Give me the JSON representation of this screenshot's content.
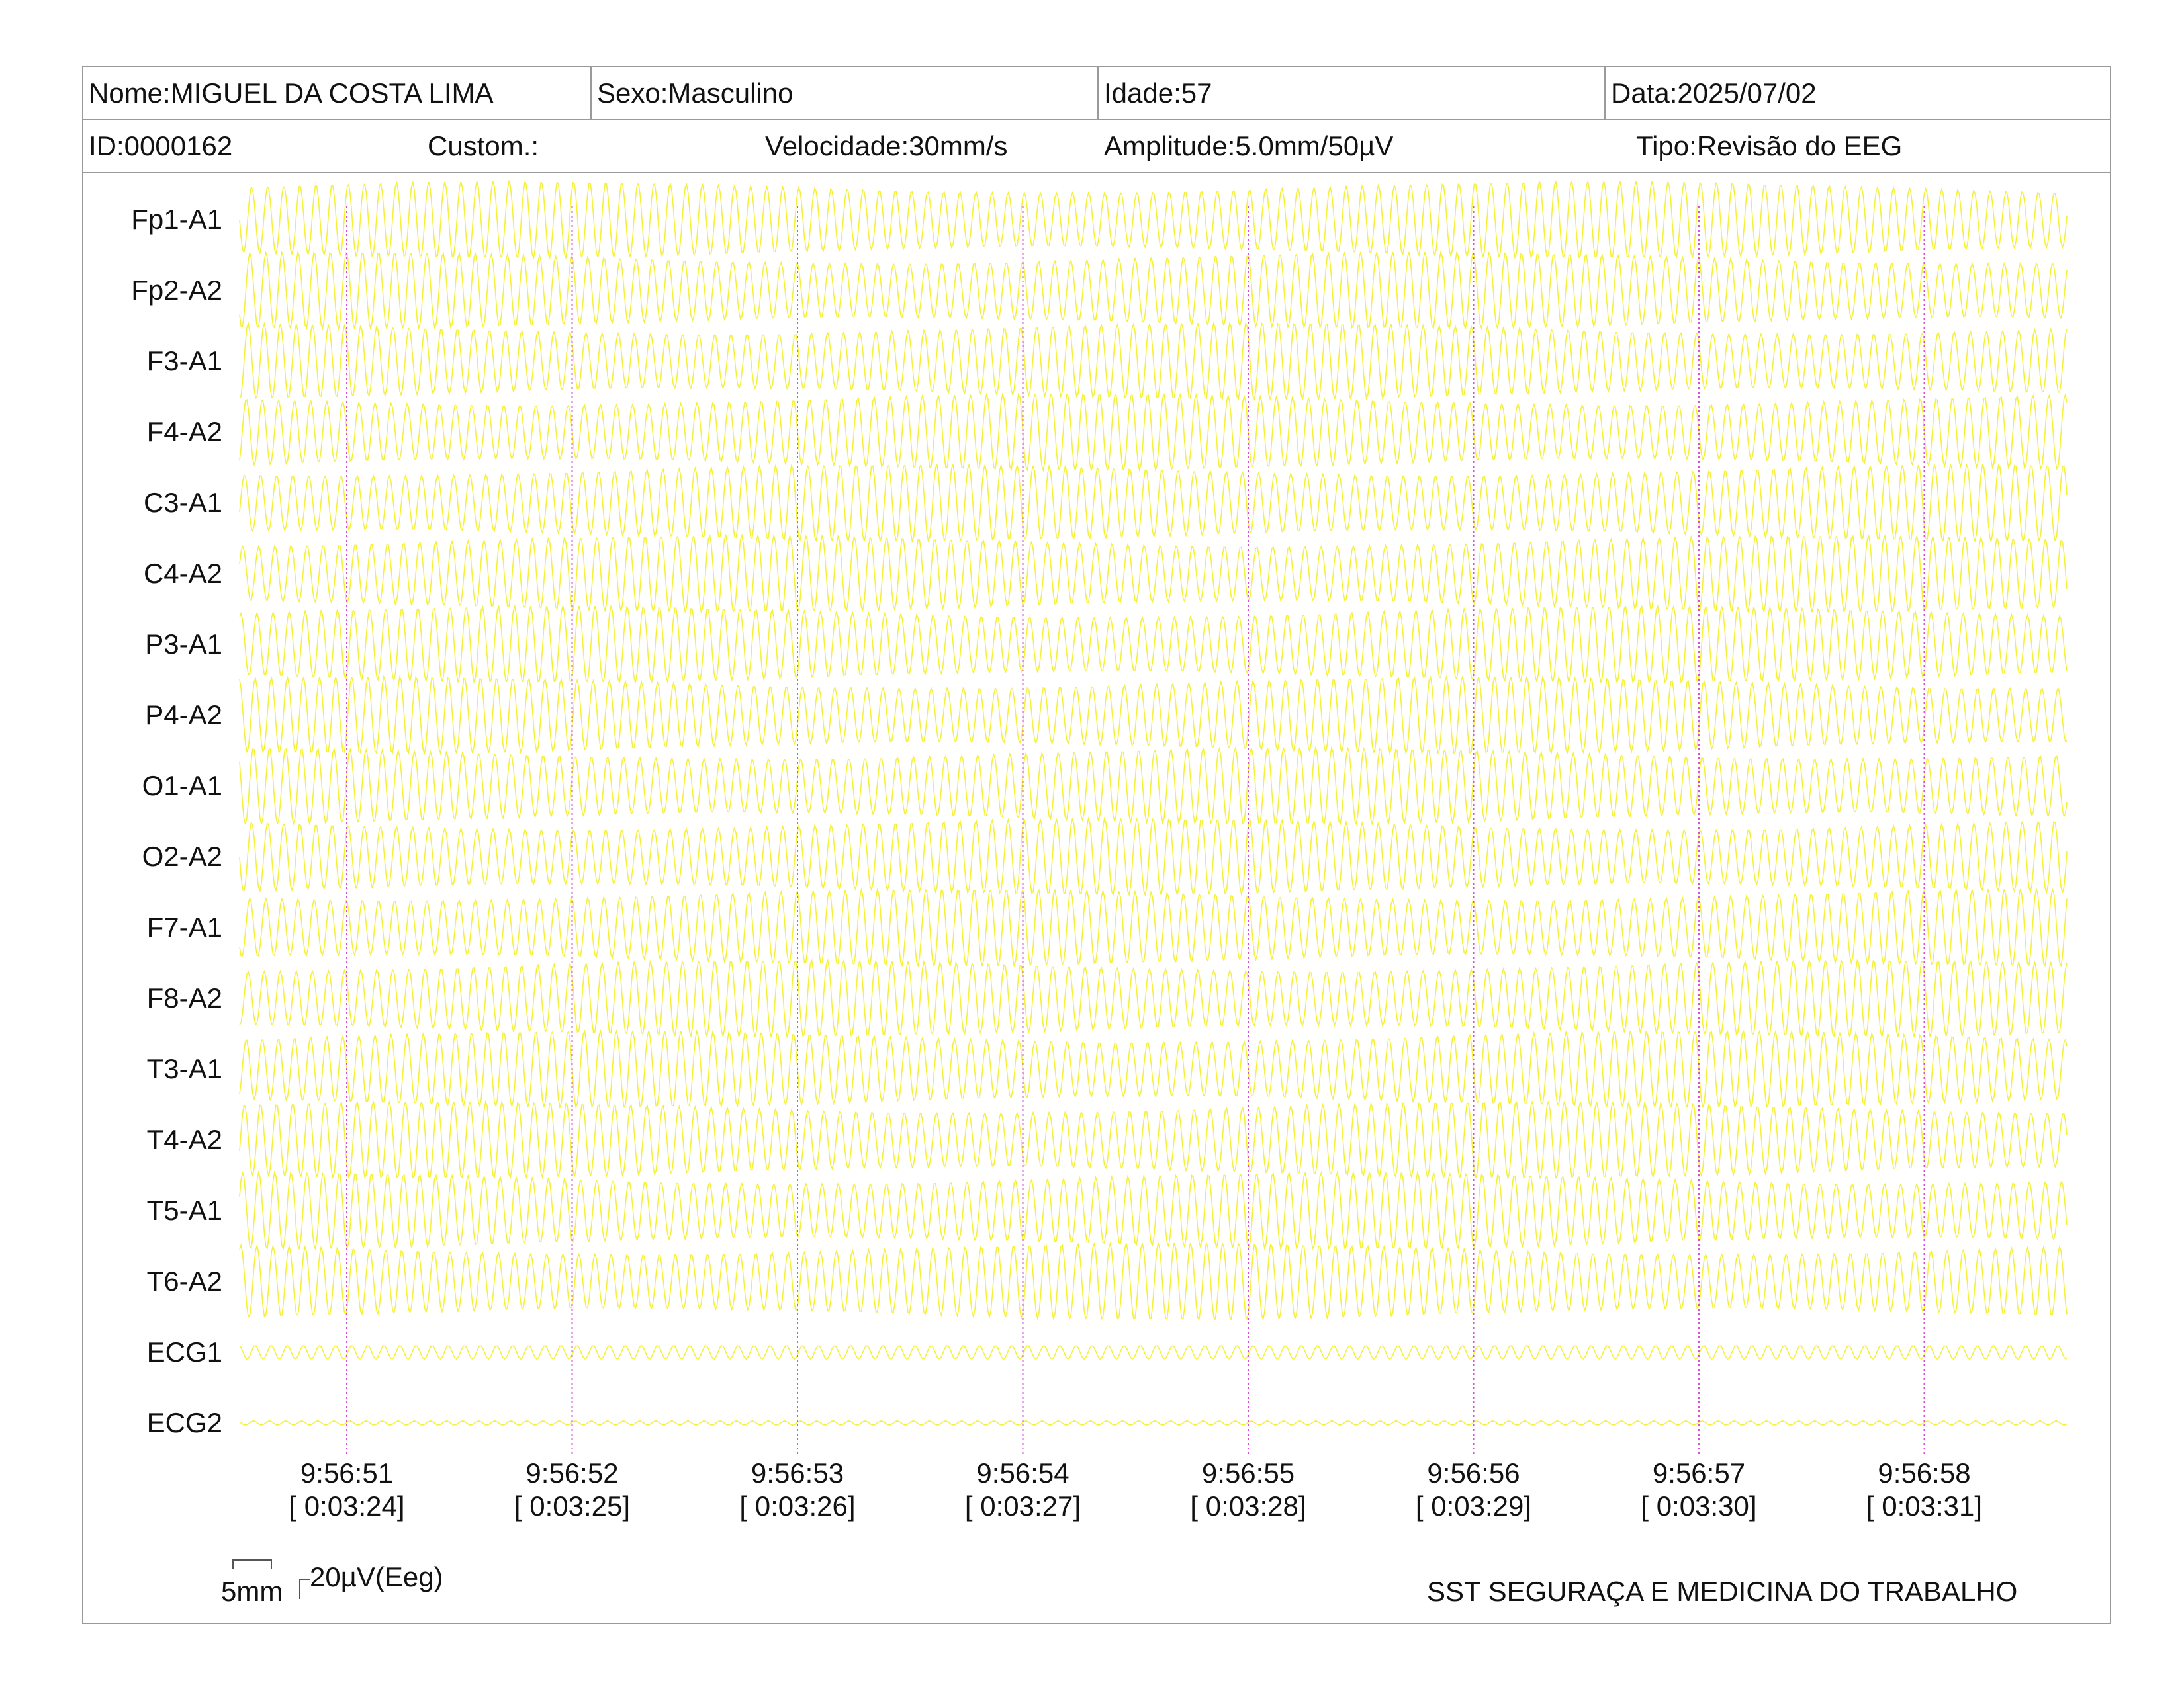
{
  "header": {
    "nome": "Nome:MIGUEL DA COSTA LIMA",
    "sexo": "Sexo:Masculino",
    "idade": "Idade:57",
    "data": "Data:2025/07/02",
    "id": "ID:0000162",
    "custom": "Custom.:",
    "velocidade": "Velocidade:30mm/s",
    "amplitude": "Amplitude:5.0mm/50µV",
    "tipo": "Tipo:Revisão do EEG"
  },
  "colors": {
    "trace": "#f5f03a",
    "marker": "#d64fd6",
    "border": "#9a9a9a"
  },
  "chart_data": {
    "type": "line",
    "channels": [
      "Fp1-A1",
      "Fp2-A2",
      "F3-A1",
      "F4-A2",
      "C3-A1",
      "C4-A2",
      "P3-A1",
      "P4-A2",
      "O1-A1",
      "O2-A2",
      "F7-A1",
      "F8-A2",
      "T3-A1",
      "T4-A2",
      "T5-A1",
      "T6-A2",
      "ECG1",
      "ECG2"
    ],
    "time_ticks": [
      {
        "clock": "9:56:51",
        "elapsed": "[ 0:03:24]"
      },
      {
        "clock": "9:56:52",
        "elapsed": "[ 0:03:25]"
      },
      {
        "clock": "9:56:53",
        "elapsed": "[ 0:03:26]"
      },
      {
        "clock": "9:56:54",
        "elapsed": "[ 0:03:27]"
      },
      {
        "clock": "9:56:55",
        "elapsed": "[ 0:03:28]"
      },
      {
        "clock": "9:56:56",
        "elapsed": "[ 0:03:29]"
      },
      {
        "clock": "9:56:57",
        "elapsed": "[ 0:03:30]"
      },
      {
        "clock": "9:56:58",
        "elapsed": "[ 0:03:31]"
      }
    ],
    "duration_seconds": 8.6,
    "oscillation_hz": 14
  },
  "footer": {
    "scale_time": "5mm",
    "scale_amp": "20µV(Eeg)",
    "company": "SST SEGURAÇA E MEDICINA DO TRABALHO"
  }
}
